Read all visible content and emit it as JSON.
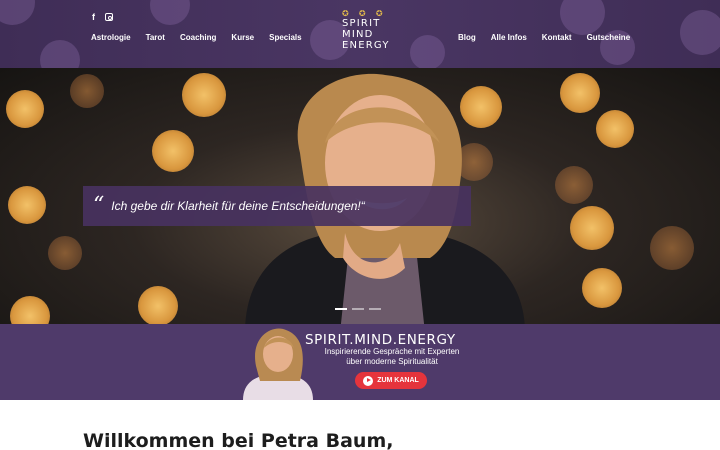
{
  "header": {
    "social": [
      "facebook-icon",
      "instagram-icon"
    ],
    "nav_left": [
      "Astrologie",
      "Tarot",
      "Coaching",
      "Kurse",
      "Specials"
    ],
    "nav_right": [
      "Blog",
      "Alle Infos",
      "Kontakt",
      "Gutscheine"
    ],
    "logo": {
      "stars": "✪ ✪ ✪",
      "line1": "SPIRIT",
      "line2": "MIND",
      "line3": "ENERGY"
    }
  },
  "hero": {
    "quote_mark": "“",
    "quote": "Ich gebe dir Klarheit für deine Entscheidungen!“",
    "slides": 3,
    "active_slide": 1
  },
  "banner": {
    "title": "SPIRIT.MIND.ENERGY",
    "subtitle_line1": "Inspirierende Gespräche mit Experten",
    "subtitle_line2": "über moderne Spiritualität",
    "button": "ZUM KANAL"
  },
  "main": {
    "welcome": "Willkommen bei Petra Baum,"
  },
  "colors": {
    "header": "#45325c",
    "quote_bg": "#48326a",
    "banner": "#4f3a6a",
    "button": "#e5343c",
    "stars": "#e0b84c"
  }
}
